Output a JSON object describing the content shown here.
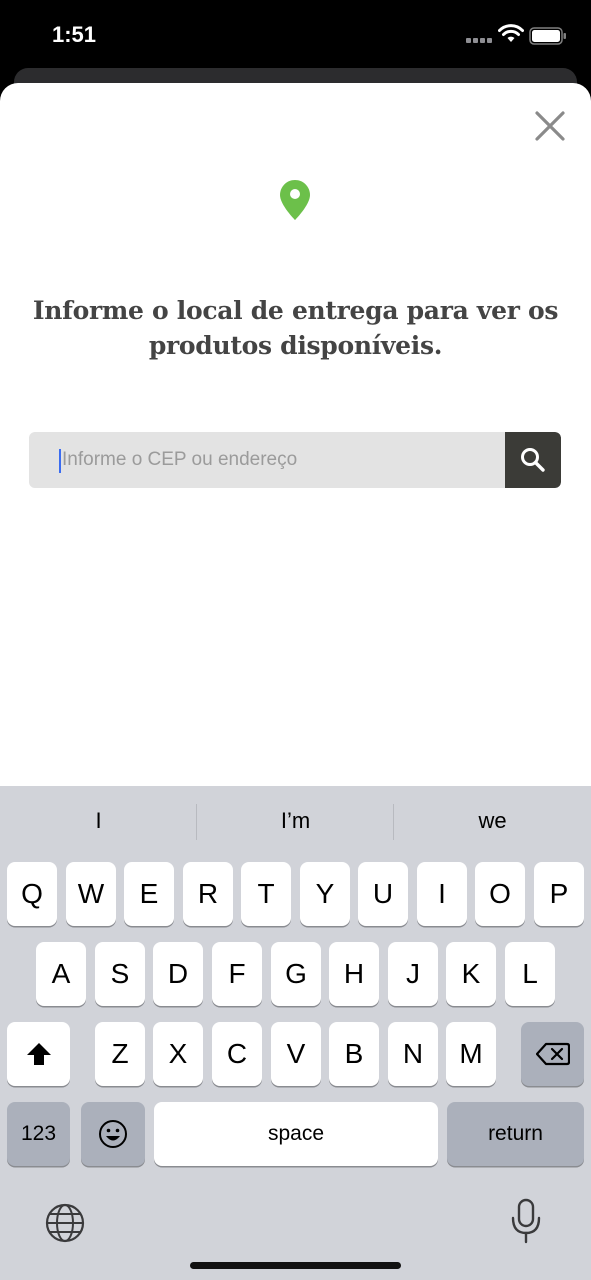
{
  "status": {
    "time": "1:51"
  },
  "modal": {
    "headline": "Informe o local de entrega para ver os produtos disponíveis.",
    "search": {
      "placeholder": "Informe o CEP ou endereço",
      "value": ""
    },
    "pin_color": "#6cc04a",
    "button_color": "#3b3b37"
  },
  "keyboard": {
    "suggestions": [
      "I",
      "I’m",
      "we"
    ],
    "row1": [
      "Q",
      "W",
      "E",
      "R",
      "T",
      "Y",
      "U",
      "I",
      "O",
      "P"
    ],
    "row2": [
      "A",
      "S",
      "D",
      "F",
      "G",
      "H",
      "J",
      "K",
      "L"
    ],
    "row3": [
      "Z",
      "X",
      "C",
      "V",
      "B",
      "N",
      "M"
    ],
    "numbers_label": "123",
    "space_label": "space",
    "return_label": "return"
  },
  "icons": [
    "close-icon",
    "location-pin-icon",
    "search-icon",
    "shift-icon",
    "backspace-icon",
    "emoji-icon",
    "globe-icon",
    "microphone-icon",
    "wifi-icon",
    "battery-icon"
  ]
}
